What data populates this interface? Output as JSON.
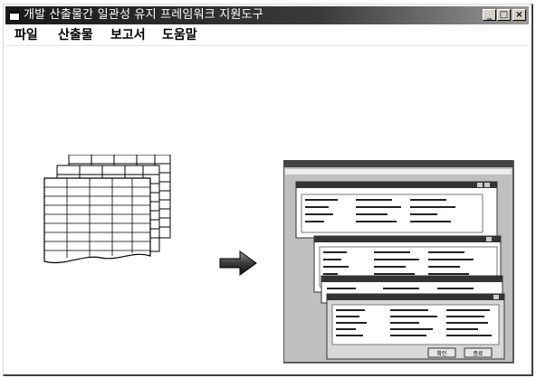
{
  "window": {
    "title": "개발 산출물간 일관성 유지 프레임워크 지원도구",
    "buttons": {
      "minimize": "_",
      "maximize": "□",
      "close": "×"
    }
  },
  "menu": {
    "items": [
      {
        "label": "파일"
      },
      {
        "label": "산출물"
      },
      {
        "label": "보고서"
      },
      {
        "label": "도움말"
      }
    ]
  },
  "illustration": {
    "left_icon": "document-stack-icon",
    "center_icon": "right-arrow-icon",
    "right_icon": "stacked-windows-icon",
    "dialog_buttons": [
      "확인",
      "종료"
    ]
  }
}
